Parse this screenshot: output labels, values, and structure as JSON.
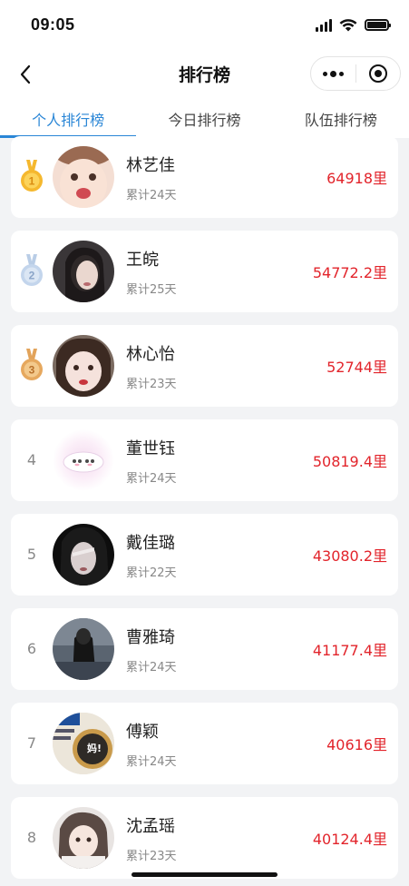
{
  "status_bar": {
    "time": "09:05"
  },
  "nav": {
    "title": "排行榜"
  },
  "tabs": [
    {
      "label": "个人排行榜",
      "active": true
    },
    {
      "label": "今日排行榜",
      "active": false
    },
    {
      "label": "队伍排行榜",
      "active": false
    }
  ],
  "colors": {
    "accent": "#2a86d6",
    "distance": "#e2242b",
    "gold": "#f5b82e",
    "silver": "#b9cde6",
    "bronze": "#e2a35a"
  },
  "ranking": [
    {
      "rank": "1",
      "medal": "gold-medal",
      "name": "林艺佳",
      "days": "累计24天",
      "distance": "64918里"
    },
    {
      "rank": "2",
      "medal": "silver-medal",
      "name": "王皖",
      "days": "累计25天",
      "distance": "54772.2里"
    },
    {
      "rank": "3",
      "medal": "bronze-medal",
      "name": "林心怡",
      "days": "累计23天",
      "distance": "52744里"
    },
    {
      "rank": "4",
      "medal": "",
      "name": "董世钰",
      "days": "累计24天",
      "distance": "50819.4里"
    },
    {
      "rank": "5",
      "medal": "",
      "name": "戴佳璐",
      "days": "累计22天",
      "distance": "43080.2里"
    },
    {
      "rank": "6",
      "medal": "",
      "name": "曹雅琦",
      "days": "累计24天",
      "distance": "41177.4里"
    },
    {
      "rank": "7",
      "medal": "",
      "name": "傅颖",
      "days": "累计24天",
      "distance": "40616里",
      "avatar_text": "妈!"
    },
    {
      "rank": "8",
      "medal": "",
      "name": "沈孟瑶",
      "days": "累计23天",
      "distance": "40124.4里"
    }
  ]
}
